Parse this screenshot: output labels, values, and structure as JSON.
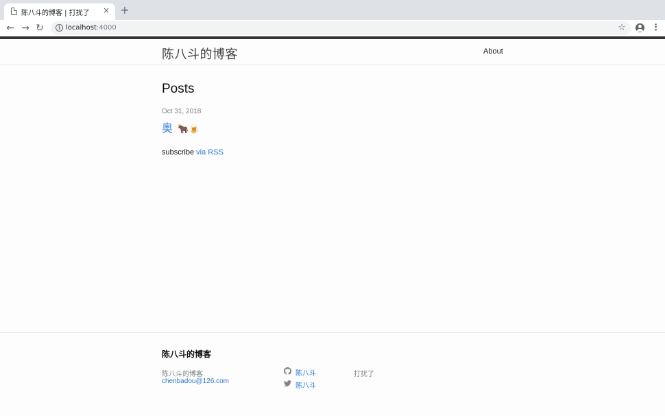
{
  "browser": {
    "tab_title": "陈八斗的博客 | 打扰了",
    "tab_close": "×",
    "new_tab": "+",
    "url_host": "localhost",
    "url_port": ":4000",
    "icons": [
      "page-icon",
      "close-icon",
      "plus-icon",
      "back-icon",
      "forward-icon",
      "reload-icon",
      "info-icon",
      "star-icon",
      "account-icon",
      "menu-icon"
    ]
  },
  "header": {
    "site_title": "陈八斗的博客",
    "nav_about": "About"
  },
  "main": {
    "heading": "Posts",
    "posts": [
      {
        "date": "Oct 31, 2018",
        "title": "奥",
        "emoji": "🐂🍺"
      }
    ],
    "subscribe_prefix": "subscribe",
    "subscribe_link": "via RSS"
  },
  "footer": {
    "heading": "陈八斗的博客",
    "name": "陈八斗的博客",
    "email": "chenbadou@126.com",
    "github_label": "陈八斗",
    "twitter_label": "陈八斗",
    "description": "打扰了"
  },
  "colors": {
    "link": "#2a7ae2",
    "muted": "#828282",
    "top_border": "#333333",
    "chrome_bg": "#dee1e6"
  }
}
